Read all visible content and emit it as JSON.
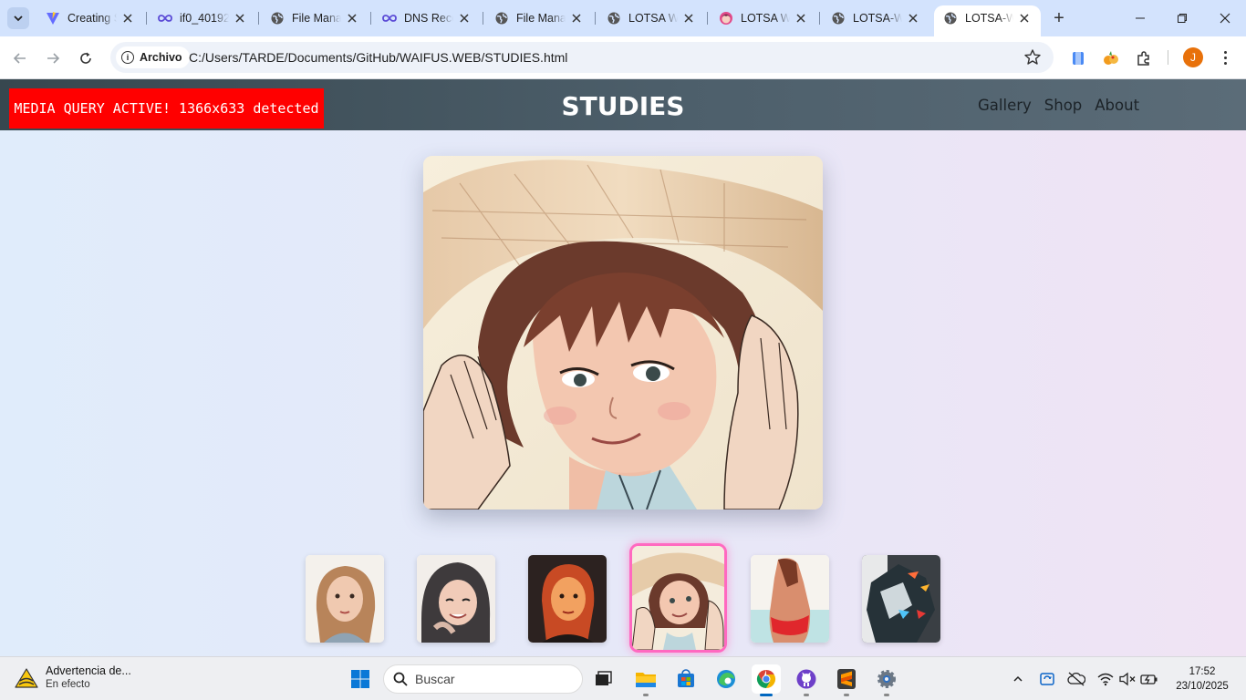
{
  "browser": {
    "tabs": [
      {
        "title": "Creating S",
        "icon": "vite-icon"
      },
      {
        "title": "if0_40192",
        "icon": "infinity-icon"
      },
      {
        "title": "File Mana",
        "icon": "globe-icon"
      },
      {
        "title": "DNS Reco",
        "icon": "infinity-icon"
      },
      {
        "title": "File Mana",
        "icon": "globe-icon"
      },
      {
        "title": "LOTSA W",
        "icon": "globe-icon"
      },
      {
        "title": "LOTSA W",
        "icon": "anime-icon"
      },
      {
        "title": "LOTSA-W",
        "icon": "globe-icon"
      },
      {
        "title": "LOTSA-W",
        "icon": "globe-icon",
        "active": true
      }
    ],
    "site_chip": "Archivo",
    "url": "C:/Users/TARDE/Documents/GitHub/WAIFUS.WEB/STUDIES.html",
    "profile_initial": "J",
    "colors": {
      "tabstrip": "#d3e3fd",
      "omnibox": "#eef2f9",
      "avatar": "#e8710a"
    }
  },
  "page": {
    "media_query_banner": "MEDIA QUERY ACTIVE! 1366x633 detected",
    "title": "STUDIES",
    "nav": [
      "Gallery",
      "Shop",
      "About"
    ],
    "main_image": "girl-straw-hat-study",
    "thumbnails": [
      {
        "subject": "girl-blonde-portrait"
      },
      {
        "subject": "girl-dark-hair-smiling"
      },
      {
        "subject": "girl-warm-light-portrait"
      },
      {
        "subject": "girl-straw-hat-study",
        "active": true
      },
      {
        "subject": "bikini-back-view"
      },
      {
        "subject": "abstract-dark-figure"
      }
    ],
    "colors": {
      "banner": "#ff0000",
      "header": "#37474f",
      "active_thumb_border": "#ff69c0"
    }
  },
  "taskbar": {
    "notification_title": "Advertencia de...",
    "notification_sub": "En efecto",
    "search_placeholder": "Buscar",
    "time": "17:52",
    "date": "23/10/2025"
  }
}
